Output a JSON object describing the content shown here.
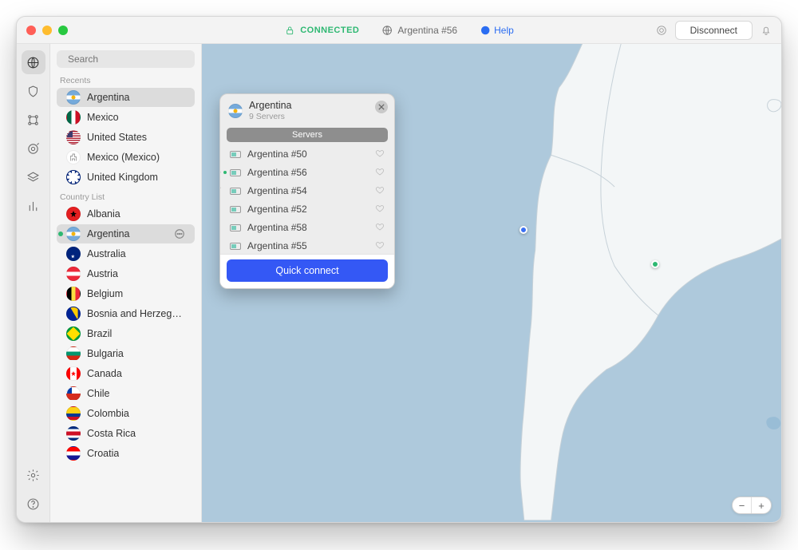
{
  "titlebar": {
    "status": "CONNECTED",
    "server": "Argentina #56",
    "help": "Help",
    "disconnect": "Disconnect"
  },
  "search": {
    "placeholder": "Search"
  },
  "sections": {
    "recents": "Recents",
    "countries": "Country List"
  },
  "recents": [
    {
      "label": "Argentina",
      "flag": "ar",
      "selected": true
    },
    {
      "label": "Mexico",
      "flag": "mx"
    },
    {
      "label": "United States",
      "flag": "us"
    },
    {
      "label": "Mexico (Mexico)",
      "flag": "city"
    },
    {
      "label": "United Kingdom",
      "flag": "gb"
    }
  ],
  "countries": [
    {
      "label": "Albania",
      "flag": "al"
    },
    {
      "label": "Argentina",
      "flag": "ar",
      "selected": true,
      "connected": true
    },
    {
      "label": "Australia",
      "flag": "au"
    },
    {
      "label": "Austria",
      "flag": "at"
    },
    {
      "label": "Belgium",
      "flag": "be"
    },
    {
      "label": "Bosnia and Herzeg…",
      "flag": "ba"
    },
    {
      "label": "Brazil",
      "flag": "br"
    },
    {
      "label": "Bulgaria",
      "flag": "bg"
    },
    {
      "label": "Canada",
      "flag": "ca"
    },
    {
      "label": "Chile",
      "flag": "cl"
    },
    {
      "label": "Colombia",
      "flag": "co"
    },
    {
      "label": "Costa Rica",
      "flag": "cr"
    },
    {
      "label": "Croatia",
      "flag": "hr"
    }
  ],
  "popover": {
    "title": "Argentina",
    "subtitle": "9 Servers",
    "tab": "Servers",
    "servers": [
      {
        "name": "Argentina #50"
      },
      {
        "name": "Argentina #56",
        "selected": true
      },
      {
        "name": "Argentina #54"
      },
      {
        "name": "Argentina #52"
      },
      {
        "name": "Argentina #58"
      },
      {
        "name": "Argentina #55"
      }
    ],
    "quick_connect": "Quick connect"
  }
}
